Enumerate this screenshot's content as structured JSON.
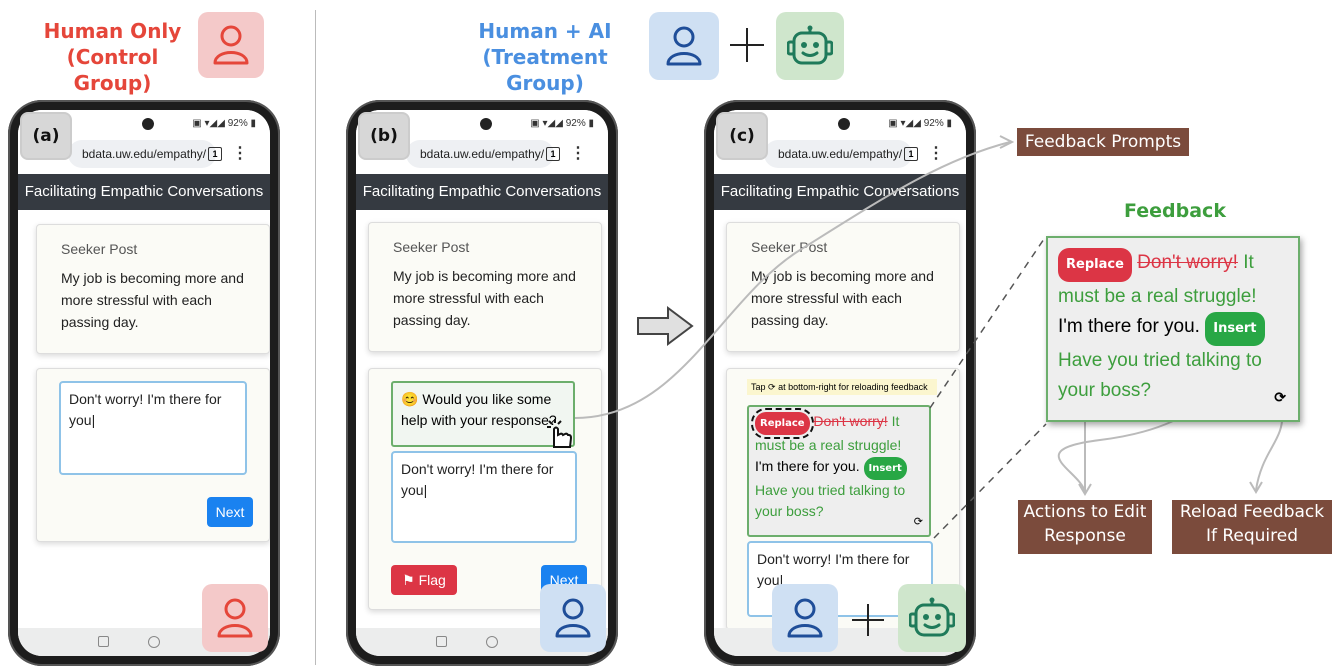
{
  "groups": {
    "control_line1": "Human Only",
    "control_line2": "(Control Group)",
    "treatment_line1": "Human + AI",
    "treatment_line2": "(Treatment Group)"
  },
  "phone_labels": {
    "a": "(a)",
    "b": "(b)",
    "c": "(c)"
  },
  "status": {
    "battery": "92%"
  },
  "browser": {
    "url": "bdata.uw.edu/empathy/",
    "tab_count": "1"
  },
  "app": {
    "title": "Facilitating Empathic Conversations"
  },
  "seeker": {
    "title": "Seeker Post",
    "text": "My job is becoming more and more stressful with each passing day."
  },
  "response": {
    "text": "Don't worry! I'm there for you"
  },
  "buttons": {
    "next": "Next",
    "flag": "Flag"
  },
  "prompt": {
    "emoji": "😊",
    "text": "Would you like some help with your response?"
  },
  "tap_hint": {
    "prefix": "Tap",
    "suffix": "at bottom-right for reloading feedback"
  },
  "feedback": {
    "heading": "Feedback",
    "replace_label": "Replace",
    "insert_label": "Insert",
    "strike_text": "Don't worry!",
    "replace_text": "It must be a real struggle!",
    "keep_text": "I'm there for you.",
    "insert_text": "Have you tried talking to your boss?"
  },
  "annotations": {
    "feedback_prompts": "Feedback Prompts",
    "actions_line1": "Actions to Edit",
    "actions_line2": "Response",
    "reload_line1": "Reload Feedback",
    "reload_line2": "If Required"
  },
  "colors": {
    "accent_red": "#e5463a",
    "accent_blue": "#4a8fe0",
    "feedback_green": "#3d9e3d",
    "annotation_brown": "#7b4b3c"
  },
  "icons": [
    "person-icon",
    "robot-icon",
    "plus-icon",
    "arrow-right-icon",
    "flag-icon",
    "tap-hand-icon",
    "reload-icon"
  ]
}
